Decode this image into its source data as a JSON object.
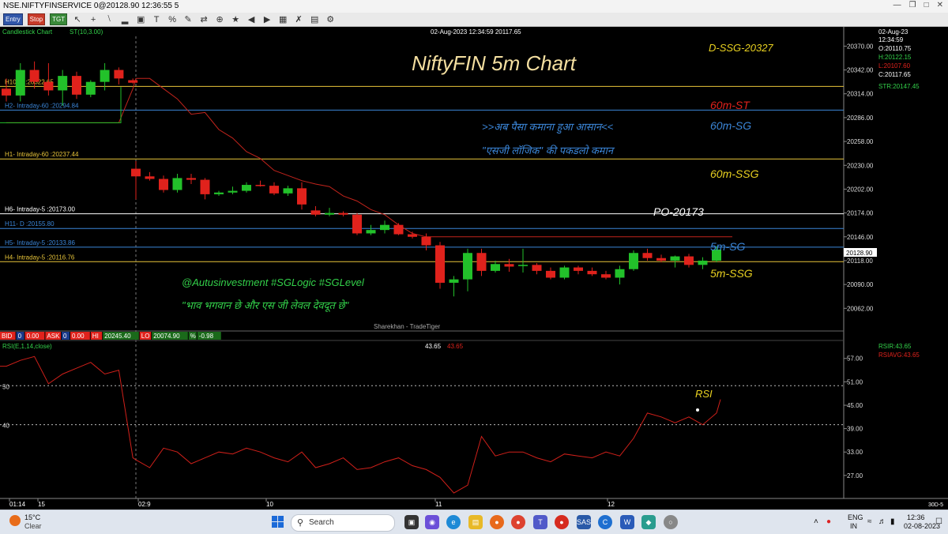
{
  "window": {
    "title": "NSE.NIFTYFINSERVICE 0@20128.90 12:36:55 5",
    "controls": [
      "min",
      "restore",
      "max",
      "close"
    ]
  },
  "toolbar": {
    "buttons": [
      "Entry",
      "Stop",
      "TGT"
    ],
    "icons": [
      "cursor-icon",
      "crosshair-icon",
      "line-icon",
      "trend-icon",
      "cube-icon",
      "text-icon",
      "percent-icon",
      "pencil-icon",
      "arrows-icon",
      "zoom-icon",
      "star-icon",
      "back-icon",
      "forward-icon",
      "calc-icon",
      "delete-icon",
      "chart-icon",
      "settings-icon"
    ]
  },
  "header": {
    "chart_label": "Candlestick Chart",
    "indicator": "ST(10,3.00)",
    "datetime": "02-Aug-2023 12:34:59 20117.65"
  },
  "info_panel": {
    "date": "02-Aug-23",
    "time": "12:34:59",
    "open": "O:20110.75",
    "high": "H:20122.15",
    "low": "L:20107.60",
    "close": "C:20117.65",
    "str": "STR:20147.45"
  },
  "title": "NiftyFIN 5m Chart",
  "annotations": {
    "d_ssg": "D-SSG-20327",
    "m60_st": "60m-ST",
    "m60_sg": "60m-SG",
    "m60_ssg": "60m-SSG",
    "po": "PO-20173",
    "m5_sg": "5m-SG",
    "m5_ssg": "5m-SSG",
    "hindi1": ">>अब पैसा कमाना हुआ आसान<<",
    "hindi2": "\"एसजी लॉजिक\" की पकडलो कमान",
    "handle": "@Autusinvestment  #SGLogic  #SGLevel",
    "quote": "\"भाव भगवान छे और एस जी लेवल देवदूत छे\"",
    "watermark": "Sharekhan - TradeTiger",
    "rsi": "RSI"
  },
  "levels": [
    {
      "label": "H10- 5 :20322.65",
      "value": 20322.65,
      "color": "#e8c53a"
    },
    {
      "label": "H2- Intraday-60 :20294.84",
      "value": 20294.84,
      "color": "#3b86d8"
    },
    {
      "label": "H1- Intraday-60 :20237.44",
      "value": 20237.44,
      "color": "#e8c53a"
    },
    {
      "label": "H6- Intraday-5 :20173.00",
      "value": 20173.0,
      "color": "#ffffff"
    },
    {
      "label": "H11- D :20155.80",
      "value": 20155.8,
      "color": "#3b86d8"
    },
    {
      "label": "H5- Intraday-5 :20133.86",
      "value": 20133.86,
      "color": "#3b86d8"
    },
    {
      "label": "H4- Intraday-5 :20116.76",
      "value": 20116.76,
      "color": "#e8c53a"
    }
  ],
  "price_axis": {
    "ticks": [
      "20370.00",
      "20342.00",
      "20314.00",
      "20286.00",
      "20258.00",
      "20230.00",
      "20202.00",
      "20174.00",
      "20146.00",
      "20118.00",
      "20090.00",
      "20062.00"
    ],
    "current": "20128.90"
  },
  "rsi_axis": {
    "ticks": [
      "57.00",
      "51.00",
      "45.00",
      "39.00",
      "33.00",
      "27.00"
    ],
    "left_ticks": [
      "50",
      "40"
    ]
  },
  "rsi_legend": {
    "label": "RSI(E,1,14,close)",
    "value1": "43.65",
    "value2": "43.65",
    "rsir": "RSIR:43.65",
    "rsiavg": "RSIAVG:43.65"
  },
  "bidbar": [
    "BID",
    "0",
    "0.00",
    "ASK",
    "0",
    "0.00",
    "HI",
    "20245.40",
    "LO",
    "20074.90",
    "%",
    "-0.98"
  ],
  "time_axis": {
    "labels": [
      "01:14",
      "15",
      "02:9",
      "10",
      "11",
      "12"
    ],
    "corner": "30D-5"
  },
  "taskbar": {
    "weather_temp": "15°C",
    "weather_text": "Clear",
    "search": "Search",
    "lang1": "ENG",
    "lang2": "IN",
    "time": "12:36",
    "date": "02-08-2023"
  },
  "colors": {
    "up": "#22c12a",
    "down": "#e0221c",
    "supertrend": "#c2241c",
    "rsi": "#d0201a"
  },
  "chart_data": {
    "type": "candlestick",
    "timeframe": "5m",
    "ohlc": [
      [
        20320,
        20332,
        20305,
        20312
      ],
      [
        20312,
        20350,
        20305,
        20342
      ],
      [
        20342,
        20352,
        20320,
        20328
      ],
      [
        20328,
        20350,
        20312,
        20318
      ],
      [
        20318,
        20342,
        20300,
        20335
      ],
      [
        20335,
        20340,
        20308,
        20313
      ],
      [
        20313,
        20330,
        20310,
        20328
      ],
      [
        20328,
        20350,
        20318,
        20342
      ],
      [
        20342,
        20345,
        20325,
        20332
      ],
      [
        20330,
        20332,
        20326,
        20327
      ],
      [
        20226,
        20235,
        20190,
        20217
      ],
      [
        20217,
        20222,
        20212,
        20214
      ],
      [
        20214,
        20218,
        20198,
        20201
      ],
      [
        20201,
        20220,
        20198,
        20215
      ],
      [
        20215,
        20220,
        20208,
        20213
      ],
      [
        20213,
        20215,
        20190,
        20196
      ],
      [
        20196,
        20200,
        20194,
        20198
      ],
      [
        20198,
        20205,
        20196,
        20200
      ],
      [
        20200,
        20210,
        20198,
        20207
      ],
      [
        20207,
        20212,
        20205,
        20206
      ],
      [
        20206,
        20210,
        20195,
        20197
      ],
      [
        20197,
        20206,
        20194,
        20203
      ],
      [
        20203,
        20210,
        20178,
        20184
      ],
      [
        20177,
        20182,
        20170,
        20172
      ],
      [
        20172,
        20180,
        20170,
        20174
      ],
      [
        20174,
        20176,
        20170,
        20172
      ],
      [
        20172,
        20174,
        20148,
        20150
      ],
      [
        20150,
        20160,
        20148,
        20154
      ],
      [
        20154,
        20165,
        20150,
        20160
      ],
      [
        20160,
        20162,
        20148,
        20149
      ],
      [
        20149,
        20152,
        20144,
        20146
      ],
      [
        20146,
        20150,
        20130,
        20136
      ],
      [
        20136,
        20140,
        20085,
        20092
      ],
      [
        20092,
        20100,
        20076,
        20096
      ],
      [
        20096,
        20132,
        20082,
        20127
      ],
      [
        20127,
        20132,
        20100,
        20106
      ],
      [
        20106,
        20118,
        20104,
        20114
      ],
      [
        20114,
        20120,
        20105,
        20111
      ],
      [
        20112,
        20132,
        20104,
        20113
      ],
      [
        20113,
        20115,
        20102,
        20106
      ],
      [
        20106,
        20110,
        20096,
        20098
      ],
      [
        20098,
        20112,
        20096,
        20110
      ],
      [
        20110,
        20112,
        20102,
        20106
      ],
      [
        20106,
        20110,
        20100,
        20102
      ],
      [
        20102,
        20106,
        20096,
        20098
      ],
      [
        20098,
        20112,
        20090,
        20108
      ],
      [
        20108,
        20130,
        20106,
        20127
      ],
      [
        20127,
        20132,
        20118,
        20121
      ],
      [
        20121,
        20125,
        20116,
        20118
      ],
      [
        20118,
        20124,
        20110,
        20123
      ],
      [
        20123,
        20126,
        20110,
        20113
      ],
      [
        20113,
        20122,
        20108,
        20118
      ],
      [
        20118,
        20135,
        20116,
        20131
      ]
    ],
    "supertrend_points": [
      20280,
      20280,
      20280,
      20280,
      20280,
      20280,
      20280,
      20280,
      20280,
      20320,
      20332,
      20332,
      20320,
      20308,
      20290,
      20292,
      20272,
      20262,
      20246,
      20238,
      20224,
      20218,
      20212,
      20208,
      20205,
      20194,
      20188,
      20178,
      20172,
      20160,
      20150,
      20146,
      20146,
      20146,
      20146,
      20146,
      20146,
      20146,
      20146,
      20146,
      20146,
      20146,
      20146,
      20146,
      20146,
      20146,
      20146,
      20146,
      20146,
      20146,
      20146,
      20146,
      20146
    ],
    "rsi": [
      55.0,
      56.5,
      57.5,
      50.5,
      53.0,
      54.5,
      56.0,
      53.0,
      54.0,
      31.5,
      31.0,
      29.0,
      34.0,
      33.0,
      30.0,
      31.5,
      33.0,
      32.5,
      34.0,
      33.0,
      31.5,
      30.5,
      33.0,
      29.0,
      30.0,
      31.5,
      28.5,
      29.0,
      30.5,
      31.5,
      29.5,
      28.5,
      26.5,
      22.5,
      24.5,
      37.0,
      32.0,
      33.0,
      33.0,
      31.5,
      30.5,
      32.5,
      32.0,
      31.5,
      33.0,
      32.0,
      36.5,
      43.0,
      42.0,
      40.5,
      42.0,
      40.0,
      43.0,
      46.5
    ],
    "levels": [
      20322.65,
      20294.84,
      20237.44,
      20173.0,
      20155.8,
      20133.86,
      20116.76
    ],
    "y_range": [
      20040,
      20388
    ],
    "rsi_range": [
      21.5,
      61.0
    ]
  }
}
